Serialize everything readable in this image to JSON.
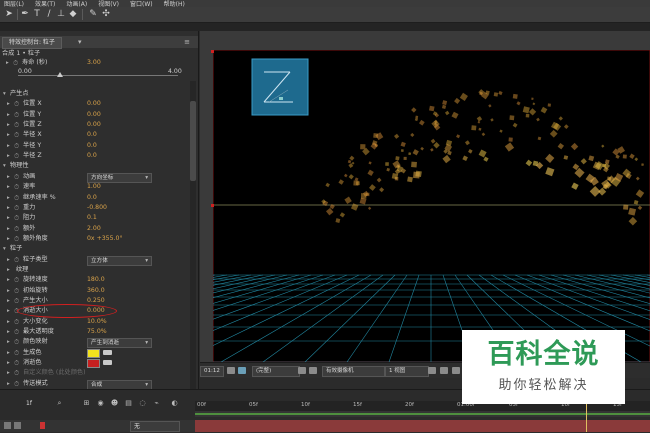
{
  "menubar": [
    "图层(L)",
    "效果(T)",
    "动画(A)",
    "视图(V)",
    "窗口(W)",
    "帮助(H)"
  ],
  "toolbar": {
    "icons": [
      "arrow-icon",
      "pen-icon",
      "text-icon",
      "brush-icon",
      "clone-stamp-icon",
      "eraser-icon",
      "roto-brush-icon",
      "puppet-pin-icon"
    ]
  },
  "effects_panel": {
    "tab_label": "特效控制台: 粒子",
    "breadcrumb": "合成 1 • 粒子",
    "top_label": "寿命 (秒)",
    "top_value": "3.00",
    "slider_min": "0.00",
    "slider_max": "4.00",
    "slider_fraction": 0.26,
    "rows": [
      {
        "type": "group",
        "label": "产生点"
      },
      {
        "type": "prop",
        "label": "位置 X",
        "value": "0.00"
      },
      {
        "type": "prop",
        "label": "位置 Y",
        "value": "0.00"
      },
      {
        "type": "prop",
        "label": "位置 Z",
        "value": "0.00"
      },
      {
        "type": "prop",
        "label": "半径 X",
        "value": "0.0"
      },
      {
        "type": "prop",
        "label": "半径 Y",
        "value": "0.0"
      },
      {
        "type": "prop",
        "label": "半径 Z",
        "value": "0.0"
      },
      {
        "type": "group",
        "label": "物理性"
      },
      {
        "type": "dropdown",
        "label": "动画",
        "value": "方向坐标"
      },
      {
        "type": "prop",
        "label": "速率",
        "value": "1.00"
      },
      {
        "type": "prop",
        "label": "继承速率 %",
        "value": "0.0"
      },
      {
        "type": "prop",
        "label": "重力",
        "value": "-0.800"
      },
      {
        "type": "prop",
        "label": "阻力",
        "value": "0.1"
      },
      {
        "type": "prop",
        "label": "额外",
        "value": "2.00"
      },
      {
        "type": "prop",
        "label": "额外角度",
        "value": "0x +355.0°"
      },
      {
        "type": "group",
        "label": "粒子"
      },
      {
        "type": "dropdown",
        "label": "粒子类型",
        "value": "立方体"
      },
      {
        "type": "subgroup",
        "label": "纹理"
      },
      {
        "type": "prop",
        "label": "旋转速度",
        "value": "180.0"
      },
      {
        "type": "prop",
        "label": "初始旋转",
        "value": "360.0"
      },
      {
        "type": "prop",
        "label": "产生大小",
        "value": "0.250"
      },
      {
        "type": "prop",
        "label": "消逝大小",
        "value": "0.000",
        "highlight": true
      },
      {
        "type": "prop",
        "label": "大小变化",
        "value": "10.0%"
      },
      {
        "type": "prop",
        "label": "最大透明度",
        "value": "75.0%"
      },
      {
        "type": "dropdown",
        "label": "颜色映射",
        "value": "产生到消逝"
      },
      {
        "type": "color",
        "label": "生成色",
        "color": "#f2e21e"
      },
      {
        "type": "color",
        "label": "消逝色",
        "color": "#c62020"
      },
      {
        "type": "dim",
        "label": "自定义颜色 (此处颜色)"
      },
      {
        "type": "dropdown",
        "label": "传送模式",
        "value": "合成"
      },
      {
        "type": "group",
        "label": "摄像机"
      }
    ]
  },
  "viewer": {
    "zoom": "01:12",
    "resolution": "(完整)",
    "camera": "有效摄像机",
    "views": "1 视图",
    "camera_icon_letter": "Z"
  },
  "timeline": {
    "timecode": "1f",
    "ticks": [
      "00f",
      "05f",
      "10f",
      "15f",
      "20f",
      "01:00f",
      "05f",
      "10f",
      "15f"
    ],
    "layer_mode": "无",
    "playhead_fraction": 0.86
  },
  "watermark": {
    "line1": "百科全说",
    "line2": "助你轻松解决"
  },
  "colors": {
    "value_orange": "#d8a24a",
    "grid_cyan": "#2aa9c8",
    "watermark_green": "#2e9a57",
    "highlight_red": "#d02020"
  }
}
